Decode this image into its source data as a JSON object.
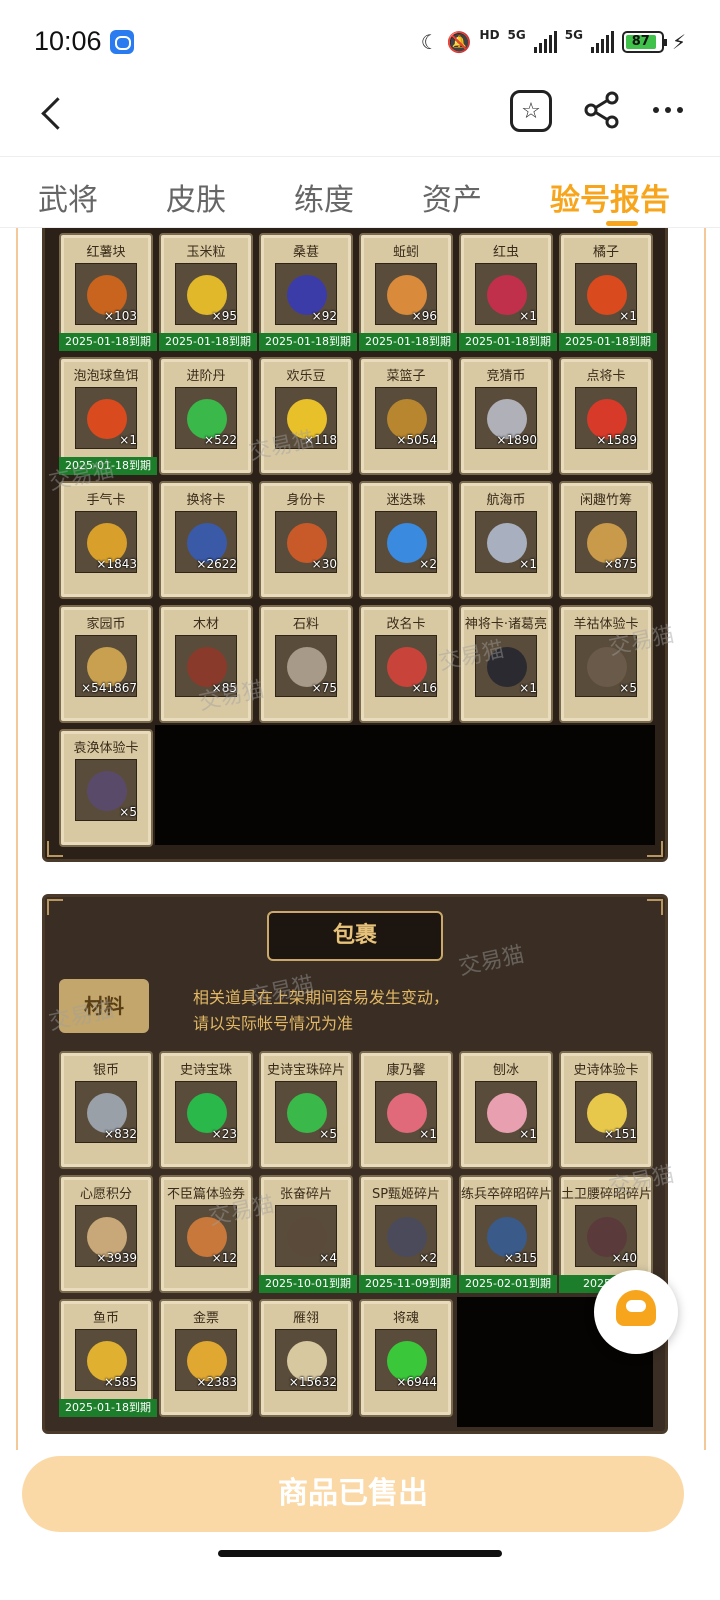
{
  "status": {
    "time": "10:06",
    "battery": "87",
    "hd": "HD",
    "net1": "5G",
    "net2": "5G"
  },
  "tabs": [
    {
      "label": "武将",
      "active": false
    },
    {
      "label": "皮肤",
      "active": false
    },
    {
      "label": "练度",
      "active": false
    },
    {
      "label": "资产",
      "active": false
    },
    {
      "label": "验号报告",
      "active": true
    }
  ],
  "top_panel": {
    "items": [
      {
        "name": "红薯块",
        "qty": "×103",
        "expiry": "2025-01-18到期",
        "color": "#c8641e"
      },
      {
        "name": "玉米粒",
        "qty": "×95",
        "expiry": "2025-01-18到期",
        "color": "#e0b82a"
      },
      {
        "name": "桑葚",
        "qty": "×92",
        "expiry": "2025-01-18到期",
        "color": "#3b3ca8"
      },
      {
        "name": "蚯蚓",
        "qty": "×96",
        "expiry": "2025-01-18到期",
        "color": "#d98a3a"
      },
      {
        "name": "红虫",
        "qty": "×1",
        "expiry": "2025-01-18到期",
        "color": "#c0304a"
      },
      {
        "name": "橘子",
        "qty": "×1",
        "expiry": "2025-01-18到期",
        "color": "#d94a1e"
      },
      {
        "name": "泡泡球鱼饵",
        "qty": "×1",
        "expiry": "2025-01-18到期",
        "color": "#d94a1e"
      },
      {
        "name": "进阶丹",
        "qty": "×522",
        "expiry": "",
        "color": "#3ab84a"
      },
      {
        "name": "欢乐豆",
        "qty": "×118",
        "expiry": "",
        "color": "#e8c02a"
      },
      {
        "name": "菜篮子",
        "qty": "×5054",
        "expiry": "",
        "color": "#b8862e"
      },
      {
        "name": "竞猜币",
        "qty": "×1890",
        "expiry": "",
        "color": "#b0b0b8"
      },
      {
        "name": "点将卡",
        "qty": "×1589",
        "expiry": "",
        "color": "#d83a2a"
      },
      {
        "name": "手气卡",
        "qty": "×1843",
        "expiry": "",
        "color": "#d8a02a"
      },
      {
        "name": "换将卡",
        "qty": "×2622",
        "expiry": "",
        "color": "#3a5aa8"
      },
      {
        "name": "身份卡",
        "qty": "×30",
        "expiry": "",
        "color": "#c85a2a"
      },
      {
        "name": "迷迭珠",
        "qty": "×2",
        "expiry": "",
        "color": "#3a8ae0"
      },
      {
        "name": "航海币",
        "qty": "×1",
        "expiry": "",
        "color": "#a8b0c0"
      },
      {
        "name": "闲趣竹筹",
        "qty": "×875",
        "expiry": "",
        "color": "#c89a4a"
      },
      {
        "name": "家园币",
        "qty": "×541867",
        "expiry": "",
        "color": "#c8a050"
      },
      {
        "name": "木材",
        "qty": "×85",
        "expiry": "",
        "color": "#8a3a2a"
      },
      {
        "name": "石料",
        "qty": "×75",
        "expiry": "",
        "color": "#a89a88"
      },
      {
        "name": "改名卡",
        "qty": "×16",
        "expiry": "",
        "color": "#c8443a"
      },
      {
        "name": "神将卡·诸葛亮",
        "qty": "×1",
        "expiry": "",
        "color": "#2a2a30"
      },
      {
        "name": "羊祜体验卡",
        "qty": "×5",
        "expiry": "",
        "color": "#6a5a4a"
      },
      {
        "name": "袁涣体验卡",
        "qty": "×5",
        "expiry": "",
        "color": "#5a4a6a"
      }
    ]
  },
  "bottom_panel": {
    "title": "包裹",
    "material_tab": "材料",
    "notice_line1": "相关道具在上架期间容易发生变动，",
    "notice_line2": "请以实际帐号情况为准",
    "items": [
      {
        "name": "银币",
        "qty": "×832",
        "expiry": "",
        "color": "#9aa0a8"
      },
      {
        "name": "史诗宝珠",
        "qty": "×23",
        "expiry": "",
        "color": "#2ab84a"
      },
      {
        "name": "史诗宝珠碎片",
        "qty": "×5",
        "expiry": "",
        "color": "#3ab84a"
      },
      {
        "name": "康乃馨",
        "qty": "×1",
        "expiry": "",
        "color": "#e06a7a"
      },
      {
        "name": "刨冰",
        "qty": "×1",
        "expiry": "",
        "color": "#e8a0b0"
      },
      {
        "name": "史诗体验卡",
        "qty": "×151",
        "expiry": "",
        "color": "#e8c84a"
      },
      {
        "name": "心愿积分",
        "qty": "×3939",
        "expiry": "",
        "color": "#c8a878"
      },
      {
        "name": "不臣篇体验券",
        "qty": "×12",
        "expiry": "",
        "color": "#c8783a"
      },
      {
        "name": "张奋碎片",
        "qty": "×4",
        "expiry": "2025-10-01到期",
        "color": "#5a4a3a"
      },
      {
        "name": "SP甄姬碎片",
        "qty": "×2",
        "expiry": "2025-11-09到期",
        "color": "#4a4a5a"
      },
      {
        "name": "练兵卒碎昭碎片",
        "qty": "×315",
        "expiry": "2025-02-01到期",
        "color": "#3a5a8a"
      },
      {
        "name": "土卫腰碎昭碎片",
        "qty": "×40",
        "expiry": "2025-05-",
        "color": "#5a3a3a"
      },
      {
        "name": "鱼币",
        "qty": "×585",
        "expiry": "2025-01-18到期",
        "color": "#e0b030"
      },
      {
        "name": "金票",
        "qty": "×2383",
        "expiry": "",
        "color": "#e0a830"
      },
      {
        "name": "雁翎",
        "qty": "×15632",
        "expiry": "",
        "color": "#d8c8a0"
      },
      {
        "name": "将魂",
        "qty": "×6944",
        "expiry": "",
        "color": "#3ac83a"
      }
    ]
  },
  "watermark": "交易猫",
  "bottom_button": "商品已售出"
}
